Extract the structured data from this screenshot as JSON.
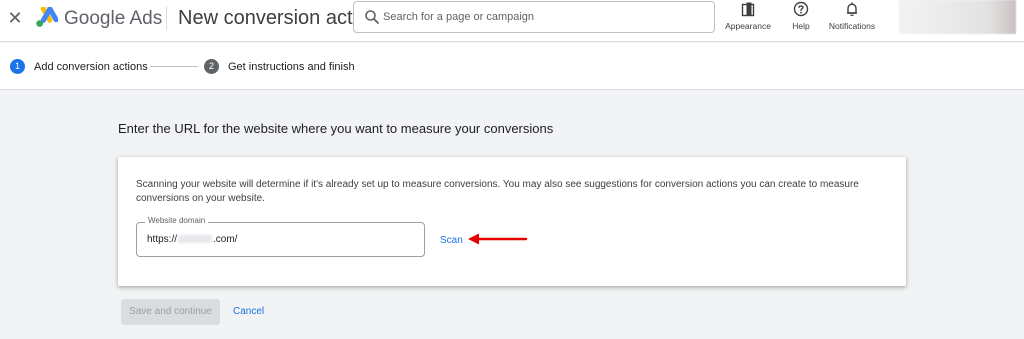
{
  "header": {
    "close_glyph": "✕",
    "brand": "Google Ads",
    "page_title": "New conversion action",
    "search": {
      "placeholder": "Search for a page or campaign",
      "icon": "search-icon"
    },
    "tools": [
      {
        "label": "Appearance",
        "icon": "appearance-icon"
      },
      {
        "label": "Help",
        "icon": "help-icon"
      },
      {
        "label": "Notifications",
        "icon": "bell-icon"
      }
    ],
    "logo_colors": {
      "blue": "#4285F4",
      "yellow": "#FBBC04",
      "green": "#34A853"
    }
  },
  "stepper": {
    "steps": [
      {
        "number": "1",
        "label": "Add conversion actions",
        "state": "active"
      },
      {
        "number": "2",
        "label": "Get instructions and finish",
        "state": "inactive"
      }
    ]
  },
  "main": {
    "heading": "Enter the URL for the website where you want to measure your conversions",
    "card": {
      "description": "Scanning your website will determine if it's already set up to measure conversions. You may also see suggestions for conversion actions you can create to measure conversions on your website.",
      "field_label": "Website domain",
      "field_value_prefix": "https://",
      "field_value_suffix": ".com/",
      "scan_label": "Scan"
    },
    "save_label": "Save and continue",
    "cancel_label": "Cancel"
  },
  "colors": {
    "accent": "#1a73e8",
    "annotation_arrow": "#e60000",
    "page_bg": "#f1f3f4"
  }
}
